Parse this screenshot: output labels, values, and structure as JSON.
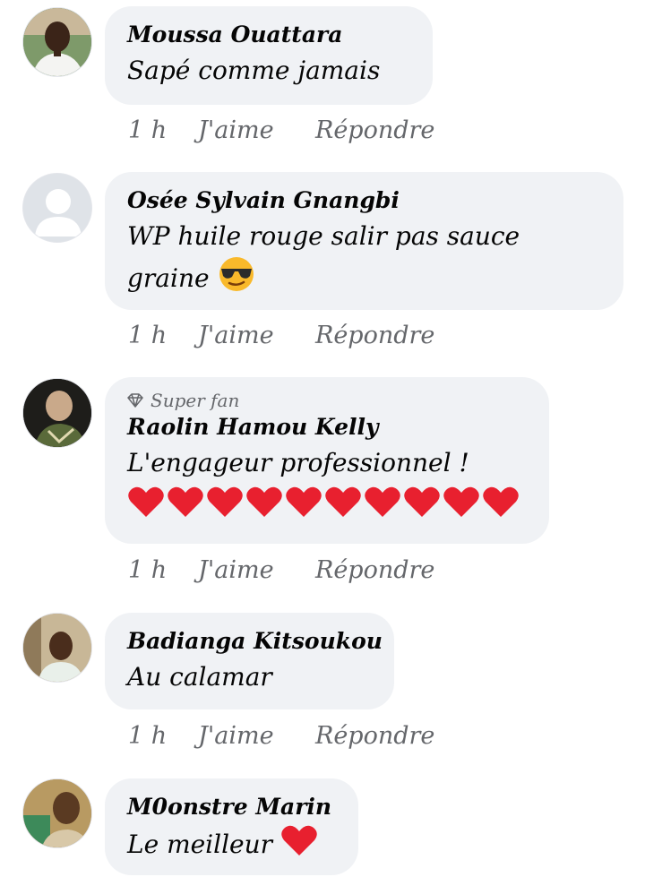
{
  "actions": {
    "time": "1 h",
    "like": "J'aime",
    "reply": "Répondre"
  },
  "comments": [
    {
      "author": "Moussa Ouattara",
      "text": "Sapé comme jamais"
    },
    {
      "author": "Osée Sylvain Gnangbi",
      "text_line1": "WP huile rouge salir pas sauce",
      "text_line2": "graine",
      "emoji": "sunglasses-emoji"
    },
    {
      "badge": "Super fan",
      "author": "Raolin Hamou Kelly",
      "text": "L'engageur professionnel !",
      "emoji": "red-heart",
      "emoji_count": 10
    },
    {
      "author": "Badianga Kitsoukou",
      "text": "Au calamar"
    },
    {
      "author": "M0onstre Marin",
      "text": "Le meilleur",
      "emoji": "red-heart"
    }
  ],
  "colors": {
    "bubble": "#f0f2f5",
    "name": "#050505",
    "meta": "#65676b",
    "heart": "#e8202f"
  }
}
